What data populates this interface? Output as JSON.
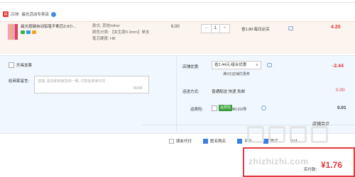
{
  "shop": {
    "label": "店铺:",
    "name": "晨光活动专卖店"
  },
  "item": {
    "title": "晨光按键自动铅笔不断芯0.9小...",
    "sku_color": "款式: 其他/other",
    "sku_spec": "颜色分类: 【女生款0.9mm】单支",
    "sku_lead": "笔芯硬度: HB",
    "price": "6.00",
    "qty_minus": "−",
    "qty_value": "1",
    "qty_plus": "+",
    "promo": "省1.80:每日必买",
    "total": "4.20"
  },
  "invoice": {
    "label": "开具发票"
  },
  "message": {
    "label": "给商家留言:",
    "placeholder": "选填, 请先和商家协商一致, 付款后商家可见",
    "count": "0/200"
  },
  "coupon": {
    "label": "店铺优惠:",
    "selected": "省2.44元:组合优惠",
    "sub": "满3元店铺优惠券",
    "amount": "-2.44"
  },
  "delivery": {
    "label": "运送方式:",
    "value": "普通配送 快递 免邮",
    "fee": "0.00"
  },
  "insurance": {
    "label": "运费险:",
    "tag": "运费险",
    "text": "¥0.01/件",
    "amount": "0.01"
  },
  "shop_total": {
    "label": "店铺合计"
  },
  "options": {
    "anonymous": "朋友代付",
    "incognito": "匿名购买",
    "third": "平台",
    "fourth": "购买",
    "fifth": "合计"
  },
  "payment": {
    "label": "实付款:",
    "amount": "¥1.76"
  },
  "watermark": {
    "text": "zhizhizhi.com"
  },
  "colors": {
    "accent": "#e4393c",
    "item_bg": "#fcf4ee",
    "options_bg": "#f0f7fe"
  }
}
